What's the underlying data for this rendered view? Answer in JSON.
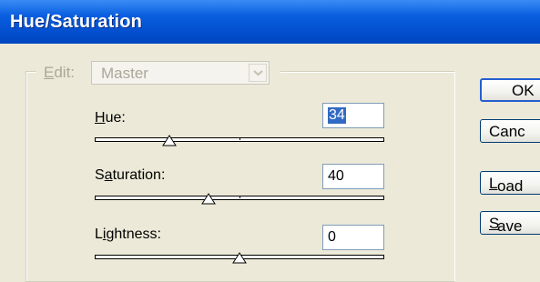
{
  "window": {
    "title": "Hue/Saturation"
  },
  "edit": {
    "label": "Edit:",
    "mnemonic": "E",
    "rest": "dit:",
    "value": "Master"
  },
  "hue": {
    "mnemonic": "H",
    "rest": "ue:",
    "value": "34",
    "slider_position": 0.27
  },
  "saturation": {
    "pre": "S",
    "mnemonic": "a",
    "rest": "turation:",
    "value": "40",
    "slider_position": 0.4
  },
  "lightness": {
    "pre": "L",
    "mnemonic": "i",
    "rest": "ghtness:",
    "value": "0",
    "slider_position": 0.5
  },
  "buttons": {
    "ok": "OK",
    "cancel": "Canc",
    "load_mnemonic": "L",
    "load_rest": "oad",
    "save_mnemonic": "S",
    "save_rest": "ave"
  },
  "icons": {
    "combo_arrow": "chevron-down-icon",
    "slider_thumb": "triangle-up-icon"
  },
  "colors": {
    "titlebar": "#0a5fe0",
    "selection": "#316ac5",
    "dialog": "#ece9d8"
  }
}
